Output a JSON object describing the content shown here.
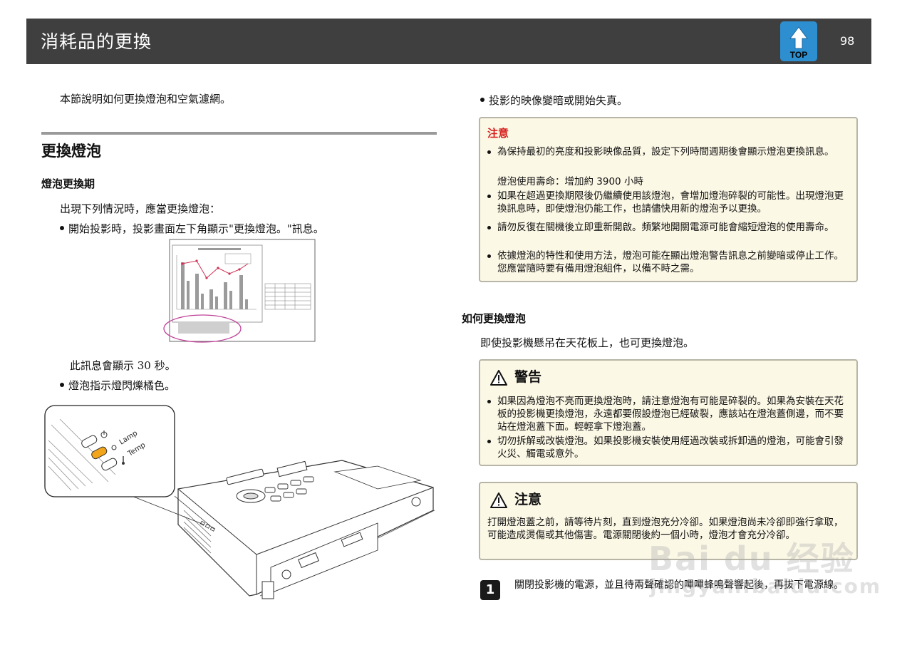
{
  "header": {
    "title": "消耗品的更換",
    "top_label": "TOP",
    "page_number": "98"
  },
  "left": {
    "intro": "本節說明如何更換燈泡和空氣濾網。",
    "section_title": "更換燈泡",
    "period_title": "燈泡更換期",
    "period_intro": "出現下列情況時，應當更換燈泡：",
    "bullet1": "開始投影時，投影畫面左下角顯示\"更換燈泡。\"訊息。",
    "message_duration": "此訊息會顯示 30 秒。",
    "bullet2": "燈泡指示燈閃爍橘色。",
    "panel_labels": {
      "lamp": "Lamp",
      "temp": "Temp"
    }
  },
  "right": {
    "bullet3": "投影的映像變暗或開始失真。",
    "note_box": {
      "title": "注意",
      "items": [
        "為保持最初的亮度和投影映像品質，設定下列時間週期後會顯示燈泡更換訊息。",
        "如果在超過更換期限後仍繼續使用該燈泡，會增加燈泡碎裂的可能性。出現燈泡更換訊息時，即使燈泡仍能工作，也請儘快用新的燈泡予以更換。",
        "請勿反復在關機後立即重新開啟。頻繁地開關電源可能會縮短燈泡的使用壽命。",
        "依據燈泡的特性和使用方法，燈泡可能在顯出燈泡警告訊息之前變暗或停止工作。您應當隨時要有備用燈泡組件，以備不時之需。"
      ],
      "lifetime": "燈泡使用壽命：增加約  3900  小時"
    },
    "how_title": "如何更換燈泡",
    "how_intro": "即使投影機懸吊在天花板上，也可更換燈泡。",
    "warning_box": {
      "title": "警告",
      "items": [
        "如果因為燈泡不亮而更換燈泡時，請注意燈泡有可能是碎裂的。如果為安裝在天花板的投影機更換燈泡，永遠都要假設燈泡已經破裂，應該站在燈泡蓋側邊，而不要站在燈泡蓋下面。輕輕拿下燈泡蓋。",
        "切勿拆解或改裝燈泡。如果投影機安裝使用經過改裝或拆卸過的燈泡，可能會引發火災、觸電或意外。"
      ]
    },
    "caution_box": {
      "title": "注意",
      "text": "打開燈泡蓋之前，請等待片刻，直到燈泡充分冷卻。如果燈泡尚未冷卻即強行拿取，可能造成燙傷或其他傷害。電源關閉後約一個小時，燈泡才會充分冷卻。"
    },
    "step1": {
      "number": "1",
      "text": "關閉投影機的電源，並且待兩聲確認的嗶嗶蜂鳴聲響起後，再拔下電源線。"
    }
  },
  "watermark": {
    "line1": "Bai du 经验",
    "line2": "jingyan.baidu.com"
  }
}
